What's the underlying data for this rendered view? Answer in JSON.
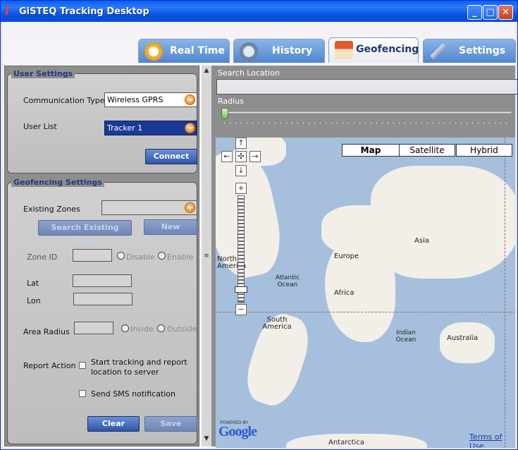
{
  "window": {
    "title": "GiSTEQ Tracking Desktop",
    "icon": "info-i-icon"
  },
  "tabs": [
    {
      "label": "Real Time",
      "icon": "stopwatch-icon",
      "active": false
    },
    {
      "label": "History",
      "icon": "magnifier-icon",
      "active": false
    },
    {
      "label": "Geofencing",
      "icon": "house-icon",
      "active": true
    },
    {
      "label": "Settings",
      "icon": "tools-icon",
      "active": false
    }
  ],
  "user_settings": {
    "title": "User Settings",
    "comm_type_label": "Communication Type",
    "comm_type_value": "Wireless GPRS",
    "user_list_label": "User List",
    "user_list_value": "Tracker 1",
    "connect_label": "Connect"
  },
  "geofencing": {
    "title": "Geofencing Settings",
    "existing_zones_label": "Existing Zones",
    "existing_zones_value": "",
    "search_button": "Search Existing Zones",
    "new_button": "New",
    "zone_id_label": "Zone ID",
    "zone_id_value": "",
    "disable_label": "Disable",
    "enable_label": "Enable",
    "lat_label": "Lat",
    "lat_value": "",
    "lon_label": "Lon",
    "lon_value": "",
    "area_radius_label": "Area Radius",
    "area_radius_value": "",
    "inside_label": "Inside",
    "outside_label": "Outside",
    "report_action_label": "Report Action",
    "report_option1": "Start tracking and report location to server",
    "report_option1_checked": false,
    "report_option2": "Send SMS notification",
    "report_option2_checked": false,
    "clear_button": "Clear",
    "save_button": "Save"
  },
  "search": {
    "label": "Search Location",
    "value": ""
  },
  "radius": {
    "label": "Radius",
    "slider_fraction": 0.0
  },
  "map": {
    "types": [
      "Map",
      "Satellite",
      "Hybrid"
    ],
    "active_type": "Map",
    "zoom_in": "+",
    "zoom_out": "−",
    "labels": {
      "asia": "Asia",
      "europe": "Europe",
      "africa": "Africa",
      "north_america": "North America",
      "south_america": "South America",
      "australia": "Australia",
      "atlantic": "Atlantic Ocean",
      "indian": "Indian Ocean",
      "antarctica": "Antarctica"
    },
    "powered_by": "POWERED BY",
    "google": "Google",
    "terms": "Terms of Use"
  },
  "colors": {
    "tab_active": "#ffffff",
    "panel_bg": "#8e8e8e",
    "button": "#2f55a8",
    "map_water": "#a5bfdd"
  }
}
